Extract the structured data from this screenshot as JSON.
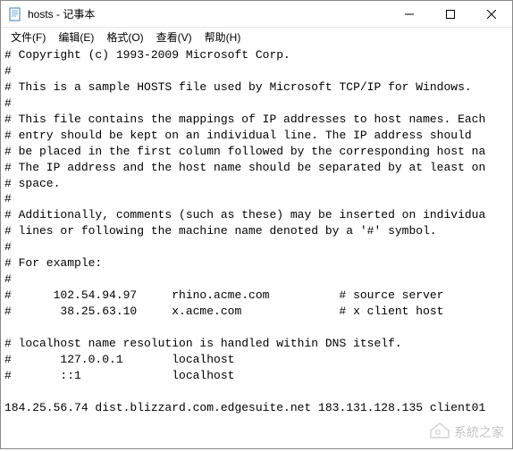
{
  "window": {
    "title": "hosts - 记事本"
  },
  "menu": {
    "file": "文件(F)",
    "edit": "编辑(E)",
    "format": "格式(O)",
    "view": "查看(V)",
    "help": "帮助(H)"
  },
  "content": "# Copyright (c) 1993-2009 Microsoft Corp.\n#\n# This is a sample HOSTS file used by Microsoft TCP/IP for Windows.\n#\n# This file contains the mappings of IP addresses to host names. Each\n# entry should be kept on an individual line. The IP address should\n# be placed in the first column followed by the corresponding host na\n# The IP address and the host name should be separated by at least on\n# space.\n#\n# Additionally, comments (such as these) may be inserted on individua\n# lines or following the machine name denoted by a '#' symbol.\n#\n# For example:\n#\n#      102.54.94.97     rhino.acme.com          # source server\n#       38.25.63.10     x.acme.com              # x client host\n\n# localhost name resolution is handled within DNS itself.\n#       127.0.0.1       localhost\n#       ::1             localhost\n\n184.25.56.74 dist.blizzard.com.edgesuite.net 183.131.128.135 client01",
  "watermark": {
    "text": "系統之家"
  }
}
